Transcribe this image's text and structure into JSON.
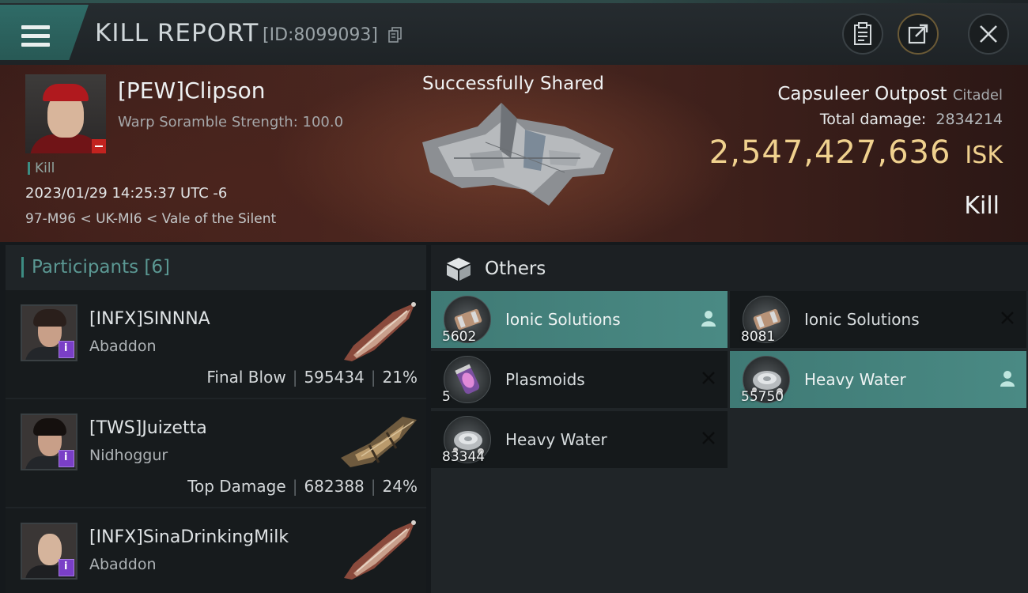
{
  "header": {
    "title": "KILL REPORT",
    "report_id": "[ID:8099093]"
  },
  "victim": {
    "name": "[PEW]Clipson",
    "scramble": "Warp Soramble Strength: 100.0",
    "kill_tag": "Kill",
    "datetime": "2023/01/29 14:25:37 UTC -6",
    "location": "97-M96 < UK-MI6 < Vale of the Silent",
    "share_status": "Successfully Shared",
    "ship_name": "Capsuleer Outpost",
    "ship_class": "Citadel",
    "total_damage_label": "Total damage:",
    "total_damage_value": "2834214",
    "isk_value": "2,547,427,636",
    "isk_unit": "ISK",
    "result": "Kill"
  },
  "participants": {
    "label": "Participants",
    "count": "[6]",
    "rows": [
      {
        "name": "[INFX]SINNNA",
        "ship": "Abaddon",
        "tag": "Final Blow",
        "damage": "595434",
        "percent": "21%"
      },
      {
        "name": "[TWS]Juizetta",
        "ship": "Nidhoggur",
        "tag": "Top Damage",
        "damage": "682388",
        "percent": "24%"
      },
      {
        "name": "[INFX]SinaDrinkingMilk",
        "ship": "Abaddon",
        "tag": "",
        "damage": "",
        "percent": ""
      }
    ]
  },
  "others": {
    "title": "Others",
    "items": [
      {
        "name": "Ionic Solutions",
        "qty": "5602",
        "selected": true,
        "icon": "canister-icon"
      },
      {
        "name": "Ionic Solutions",
        "qty": "8081",
        "selected": false,
        "icon": "canister-icon"
      },
      {
        "name": "Plasmoids",
        "qty": "5",
        "selected": false,
        "icon": "plasmoid-icon"
      },
      {
        "name": "Heavy Water",
        "qty": "55750",
        "selected": true,
        "icon": "heavy-water-icon"
      },
      {
        "name": "Heavy Water",
        "qty": "83344",
        "selected": false,
        "icon": "heavy-water-icon"
      }
    ]
  },
  "colors": {
    "accent_teal": "#3c8d83",
    "isk_gold": "#f0d18e",
    "selected_item": "#4a8a84",
    "security_negative": "#c2231f",
    "corp_badge": "#7a3fc7"
  }
}
